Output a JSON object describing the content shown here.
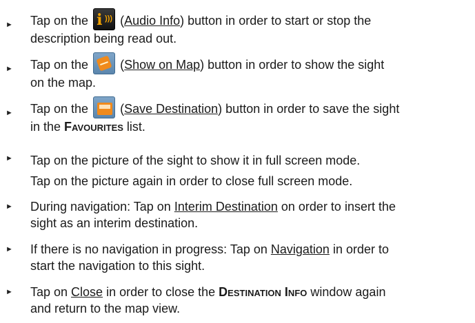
{
  "bullet_glyph": "►",
  "items": [
    {
      "pre": "Tap on the ",
      "icon": "audio-info-icon",
      "paren_open": " (",
      "link": "Audio Info",
      "post": ") button in order to start or stop the",
      "line2": "description being read out."
    },
    {
      "pre": "Tap on the ",
      "icon": "show-on-map-icon",
      "paren_open": " (",
      "link": "Show on Map",
      "post": ") button in order to show the sight",
      "line2": "on the map."
    },
    {
      "pre": "Tap on the ",
      "icon": "save-destination-icon",
      "paren_open": " (",
      "link": "Save Destination",
      "post": ") button in order to save the sight",
      "line2_pre": "in the ",
      "line2_sc": "Favourites",
      "line2_post": " list."
    },
    {
      "line1": "Tap on the picture of the sight to show it in full screen mode.",
      "line2": "Tap on the picture again in order to close full screen mode."
    },
    {
      "pre": "During navigation: Tap on ",
      "link": "Interim Destination",
      "post": " on order to insert the",
      "line2": "sight as an interim destination."
    },
    {
      "pre": "If there is no navigation in progress: Tap on ",
      "link": "Navigation",
      "post": " in order to",
      "line2": "start the navigation to this sight."
    },
    {
      "pre": "Tap on ",
      "link": "Close",
      "post": " in order to close the ",
      "sc": "Destination Info",
      "post2": " window again",
      "line2": "and return to the map view."
    }
  ]
}
